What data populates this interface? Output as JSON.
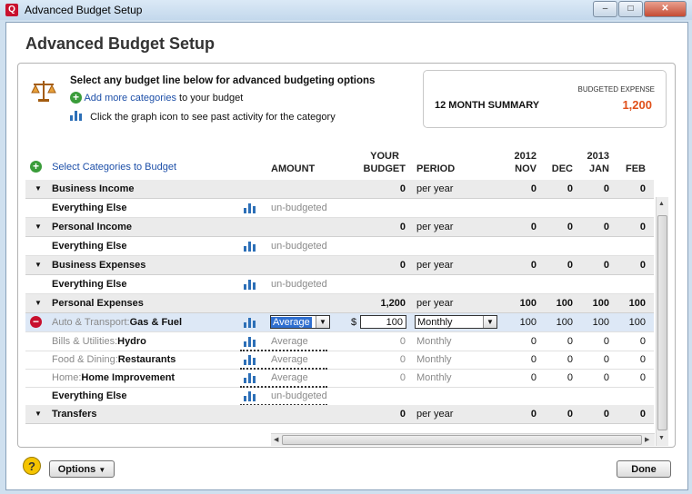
{
  "window": {
    "title": "Advanced Budget Setup",
    "app_icon": "Q",
    "minimize": "–",
    "maximize": "□",
    "close": "✕"
  },
  "page_title": "Advanced Budget Setup",
  "intro": {
    "heading": "Select any budget line below for advanced budgeting options",
    "add_link": "Add more categories",
    "add_suffix": "to your budget",
    "graph_hint": "Click the graph icon to see past activity for the category"
  },
  "summary": {
    "label": "12 MONTH SUMMARY",
    "caption": "BUDGETED EXPENSE",
    "value": "1,200"
  },
  "select_link": "Select Categories to Budget",
  "headers": {
    "amount": "AMOUNT",
    "your": "YOUR",
    "budget": "BUDGET",
    "period": "PERIOD",
    "year1": "2012",
    "year2": "2013",
    "months": [
      "NOV",
      "DEC",
      "JAN",
      "FEB"
    ]
  },
  "rows": {
    "r0": {
      "name": "Business Income",
      "budget": "0",
      "period": "per year",
      "m": [
        "0",
        "0",
        "0",
        "0"
      ]
    },
    "r1": {
      "name": "Everything Else",
      "amount": "un-budgeted"
    },
    "r2": {
      "name": "Personal Income",
      "budget": "0",
      "period": "per year",
      "m": [
        "0",
        "0",
        "0",
        "0"
      ]
    },
    "r3": {
      "name": "Everything Else",
      "amount": "un-budgeted"
    },
    "r4": {
      "name": "Business Expenses",
      "budget": "0",
      "period": "per year",
      "m": [
        "0",
        "0",
        "0",
        "0"
      ]
    },
    "r5": {
      "name": "Everything Else",
      "amount": "un-budgeted"
    },
    "r6": {
      "name": "Personal Expenses",
      "budget": "1,200",
      "period": "per year",
      "m": [
        "100",
        "100",
        "100",
        "100"
      ]
    },
    "r7": {
      "parent": "Auto & Transport:",
      "name": "Gas & Fuel",
      "amount": "Average",
      "currency": "$",
      "budget": "100",
      "period": "Monthly",
      "m": [
        "100",
        "100",
        "100",
        "100"
      ]
    },
    "r8": {
      "parent": "Bills & Utilities:",
      "name": "Hydro",
      "amount": "Average",
      "budget": "0",
      "period": "Monthly",
      "m": [
        "0",
        "0",
        "0",
        "0"
      ]
    },
    "r9": {
      "parent": "Food & Dining:",
      "name": "Restaurants",
      "amount": "Average",
      "budget": "0",
      "period": "Monthly",
      "m": [
        "0",
        "0",
        "0",
        "0"
      ]
    },
    "r10": {
      "parent": "Home:",
      "name": "Home Improvement",
      "amount": "Average",
      "budget": "0",
      "period": "Monthly",
      "m": [
        "0",
        "0",
        "0",
        "0"
      ]
    },
    "r11": {
      "name": "Everything Else",
      "amount": "un-budgeted"
    },
    "r12": {
      "name": "Transfers",
      "budget": "0",
      "period": "per year",
      "m": [
        "0",
        "0",
        "0",
        "0"
      ]
    }
  },
  "buttons": {
    "help": "?",
    "options": "Options",
    "done": "Done"
  }
}
